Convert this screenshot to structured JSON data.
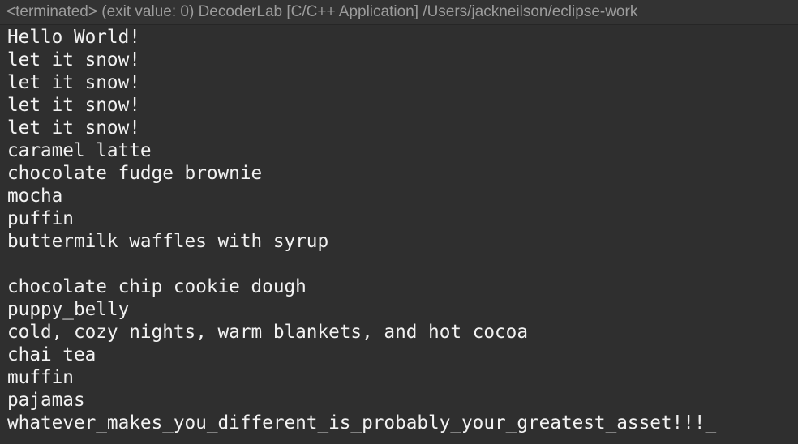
{
  "console": {
    "header": "<terminated> (exit value: 0) DecoderLab [C/C++ Application] /Users/jackneilson/eclipse-work",
    "lines": [
      "Hello World!",
      "let it snow!",
      "let it snow!",
      "let it snow!",
      "let it snow!",
      "caramel latte",
      "chocolate fudge brownie",
      "mocha",
      "puffin",
      "buttermilk waffles with syrup",
      "",
      "chocolate chip cookie dough",
      "puppy_belly",
      "cold, cozy nights, warm blankets, and hot cocoa",
      "chai tea",
      "muffin",
      "pajamas",
      "whatever_makes_you_different_is_probably_your_greatest_asset!!!_"
    ]
  },
  "colors": {
    "background": "#2f2f2f",
    "header_background": "#333333",
    "header_text": "#9c9c9c",
    "output_text": "#f2f2f2"
  }
}
